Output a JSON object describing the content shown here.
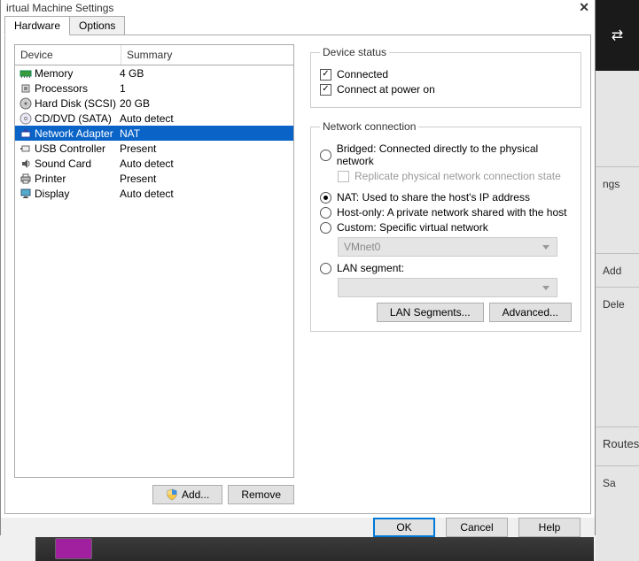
{
  "window_title": "irtual Machine Settings",
  "tabs": {
    "hardware": "Hardware",
    "options": "Options"
  },
  "device_table": {
    "headers": {
      "device": "Device",
      "summary": "Summary"
    },
    "rows": [
      {
        "icon": "memory-icon",
        "device": "Memory",
        "summary": "4 GB",
        "selected": false
      },
      {
        "icon": "cpu-icon",
        "device": "Processors",
        "summary": "1",
        "selected": false
      },
      {
        "icon": "hdd-icon",
        "device": "Hard Disk (SCSI)",
        "summary": "20 GB",
        "selected": false
      },
      {
        "icon": "cd-icon",
        "device": "CD/DVD (SATA)",
        "summary": "Auto detect",
        "selected": false
      },
      {
        "icon": "net-icon",
        "device": "Network Adapter",
        "summary": "NAT",
        "selected": true
      },
      {
        "icon": "usb-icon",
        "device": "USB Controller",
        "summary": "Present",
        "selected": false
      },
      {
        "icon": "sound-icon",
        "device": "Sound Card",
        "summary": "Auto detect",
        "selected": false
      },
      {
        "icon": "printer-icon",
        "device": "Printer",
        "summary": "Present",
        "selected": false
      },
      {
        "icon": "display-icon",
        "device": "Display",
        "summary": "Auto detect",
        "selected": false
      }
    ]
  },
  "add_remove": {
    "add": "Add...",
    "remove": "Remove"
  },
  "device_status": {
    "legend": "Device status",
    "connected": "Connected",
    "connect_power": "Connect at power on"
  },
  "net_conn": {
    "legend": "Network connection",
    "bridged": "Bridged: Connected directly to the physical network",
    "replicate": "Replicate physical network connection state",
    "nat": "NAT: Used to share the host's IP address",
    "hostonly": "Host-only: A private network shared with the host",
    "custom": "Custom: Specific virtual network",
    "custom_value": "VMnet0",
    "lan": "LAN segment:",
    "lan_segments_btn": "LAN Segments...",
    "advanced_btn": "Advanced..."
  },
  "footer": {
    "ok": "OK",
    "cancel": "Cancel",
    "help": "Help"
  },
  "bg": {
    "ngs": "ngs",
    "add": "Add",
    "dele": "Dele",
    "routes": "Routes",
    "sa": "Sa"
  }
}
